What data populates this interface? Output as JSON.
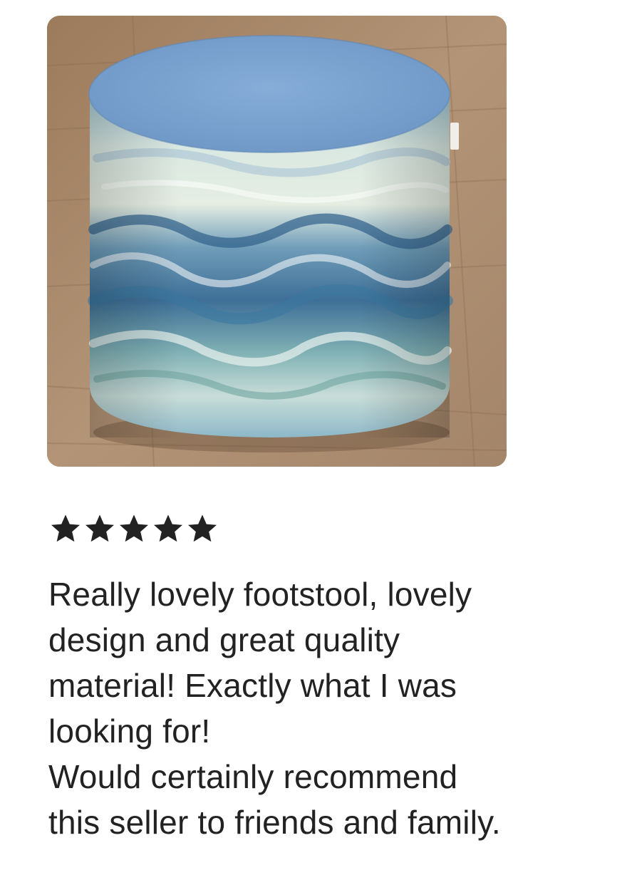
{
  "product_photo": {
    "subject": "cylindrical footstool upholstered in ocean wave print fabric with blue top",
    "colors": {
      "floor": "#a8896a",
      "top_cushion": "#7fa7d4",
      "wave_blue": "#3d6f9c",
      "wave_light": "#cfe3e6"
    }
  },
  "review": {
    "rating": 5,
    "rating_max": 5,
    "star_color": "#222222",
    "lines": [
      "Really lovely footstool, lovely",
      "design and great quality",
      "material! Exactly what I was",
      "looking for!",
      "Would certainly recommend",
      "this seller to friends and family."
    ]
  }
}
